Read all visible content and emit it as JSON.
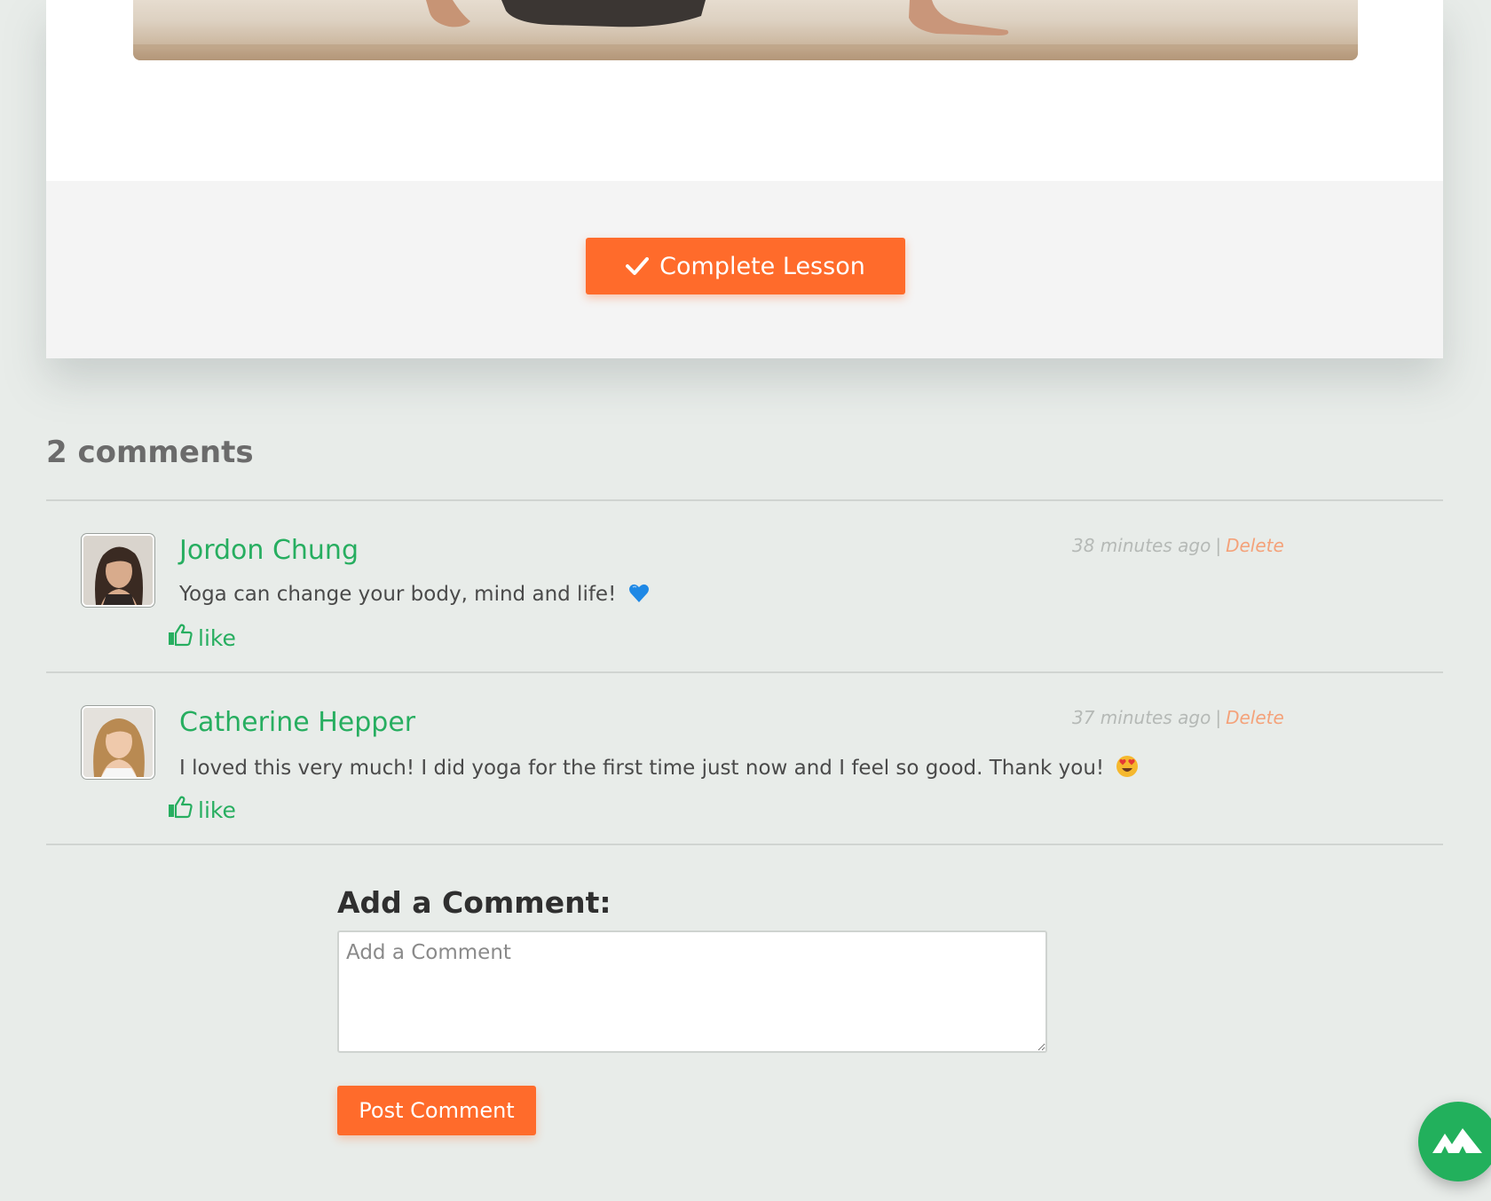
{
  "lesson": {
    "complete_label": "Complete Lesson"
  },
  "comments": {
    "heading": "2 comments",
    "items": [
      {
        "author": "Jordon Chung",
        "time": "38 minutes ago",
        "delete_label": "Delete",
        "body": "Yoga can change your body, mind and life!",
        "emoji": "blue-heart-icon",
        "like_label": "like"
      },
      {
        "author": "Catherine Hepper",
        "time": "37 minutes ago",
        "delete_label": "Delete",
        "body": "I loved this very much! I did yoga for the first time just now and I feel so good. Thank you!",
        "emoji": "heart-eyes-icon",
        "like_label": "like"
      }
    ]
  },
  "form": {
    "label": "Add a Comment:",
    "placeholder": "Add a Comment",
    "value": "",
    "submit_label": "Post Comment"
  },
  "fab": {
    "icon": "mountain-icon"
  },
  "colors": {
    "accent_orange": "#ff6b2b",
    "brand_green": "#27ae60",
    "background": "#e8ece9"
  }
}
